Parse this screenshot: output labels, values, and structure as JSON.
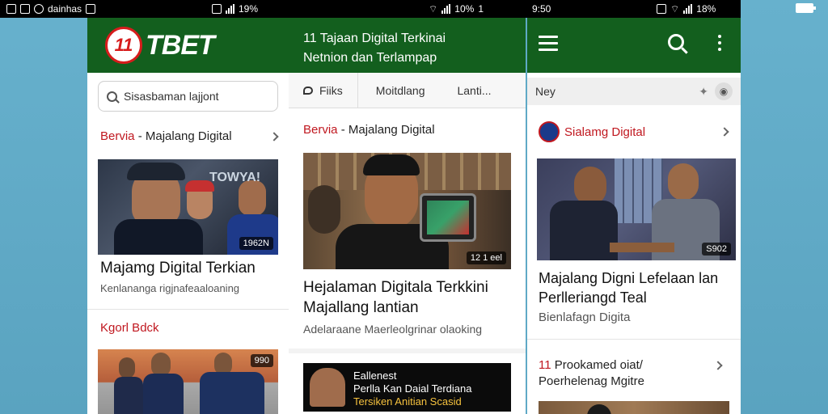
{
  "status_left": {
    "time_label": "dainhas",
    "battery_pct": "19%"
  },
  "status_mid": {
    "battery_pct": "10%",
    "extra": "1"
  },
  "status_right": {
    "time": "9:50",
    "battery_pct": "18%"
  },
  "panel1": {
    "logo_num": "11",
    "logo_text": "TBET",
    "search_placeholder": "Sisasbaman lajjont",
    "section1": {
      "prefix": "Bervia",
      "title": " - Majalang Digital"
    },
    "card1": {
      "headline": "Majamg Digital Terkian",
      "sub": "Kenlananga rigjnafeaaloaning",
      "photo_brand": "TOWYA!",
      "tag": "1962N"
    },
    "section2": {
      "title": "Kgorl Bdck"
    },
    "card2": {
      "tag": "990"
    }
  },
  "panel2": {
    "header_line1": "11 Tajaan Digital Terkinai",
    "header_line2": "Netnion dan Terlampap",
    "tabs": [
      {
        "label": "Fiiks"
      },
      {
        "label": "Moitdlang"
      },
      {
        "label": "Lanti..."
      }
    ],
    "section1": {
      "prefix": "Bervia",
      "title": " - Majalang Digital"
    },
    "card1": {
      "headline_line1": "Hejalaman Digitala Terkkini",
      "headline_line2": "Majallang lantian",
      "sub": "Adelaraane Maerleolgrinar olaoking",
      "tag": "12 1 eel"
    },
    "promo": {
      "line1": "Eallenest",
      "line2": "Perlla Kan Daial Terdiana",
      "line3": "Tersiken Anitian  Scasid"
    }
  },
  "panel3": {
    "search_text": "Ney",
    "section1": {
      "title": "Sialamg Digital"
    },
    "card1": {
      "headline_line1": "Majalang Digni Lefelaan lan",
      "headline_line2": "Perlleriangd Teal",
      "sub": "Bienlafagn Digita",
      "tag": "S902"
    },
    "section2": {
      "num": "11",
      "line1": "Prookamed oiat/",
      "line2": "Poerhelenag Mgitre"
    }
  },
  "colors": {
    "header_green": "#135f1e",
    "accent_red": "#c0171f"
  }
}
